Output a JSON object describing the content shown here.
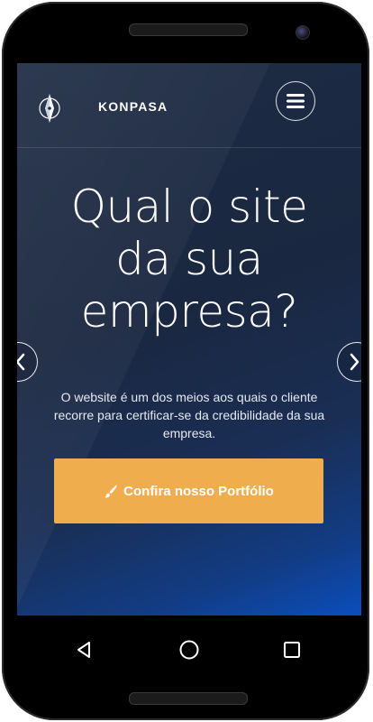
{
  "brand": {
    "name": "KONPASA"
  },
  "hero": {
    "headline_lines": [
      "Qual o site",
      "da sua",
      "empresa?"
    ],
    "subtitle": "O website é um dos meios aos quais o cliente recorre para certificar-se da credibilidade da sua empresa.",
    "cta_label": "Confira nosso Portfólio"
  },
  "icons": {
    "logo": "compass-icon",
    "menu": "hamburger-menu-icon",
    "cta": "brush-icon",
    "prev": "chevron-left-icon",
    "next": "chevron-right-icon",
    "back": "back-triangle-icon",
    "home": "home-circle-icon",
    "recents": "recents-square-icon"
  },
  "colors": {
    "cta": "#f0ad4e",
    "bg_top": "#1d2b43",
    "bg_bottom": "#0a4ebc"
  }
}
